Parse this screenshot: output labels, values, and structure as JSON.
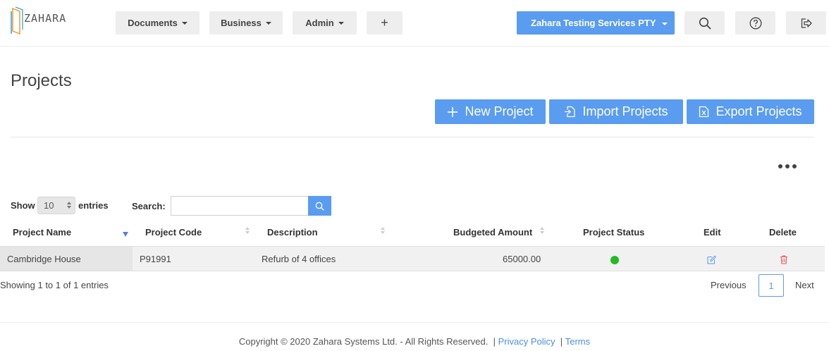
{
  "header": {
    "logo_text": "ZAHARA",
    "menus": [
      {
        "label": "Documents"
      },
      {
        "label": "Business"
      },
      {
        "label": "Admin"
      }
    ],
    "add_label": "+",
    "company": "Zahara Testing Services PTY"
  },
  "page": {
    "title": "Projects",
    "actions": {
      "new": "New Project",
      "import": "Import Projects",
      "export": "Export Projects"
    }
  },
  "table_controls": {
    "show_label": "Show",
    "length_value": "10",
    "entries_label": "entries",
    "search_label": "Search:",
    "search_value": ""
  },
  "table": {
    "columns": [
      "Project Name",
      "Project Code",
      "Description",
      "Budgeted Amount",
      "Project Status",
      "Edit",
      "Delete"
    ],
    "rows": [
      {
        "name": "Cambridge House",
        "code": "P91991",
        "description": "Refurb of 4 offices",
        "amount": "65000.00",
        "status_color": "#22bb22"
      }
    ]
  },
  "pagination": {
    "info": "Showing 1 to 1 of 1 entries",
    "previous": "Previous",
    "current": "1",
    "next": "Next"
  },
  "footer": {
    "copyright": "Copyright © 2020 Zahara Systems Ltd. - All Rights Reserved.",
    "privacy": "Privacy Policy",
    "terms": "Terms"
  },
  "colors": {
    "accent": "#5a9cf0",
    "delete": "#e05555",
    "status_active": "#22bb22"
  }
}
